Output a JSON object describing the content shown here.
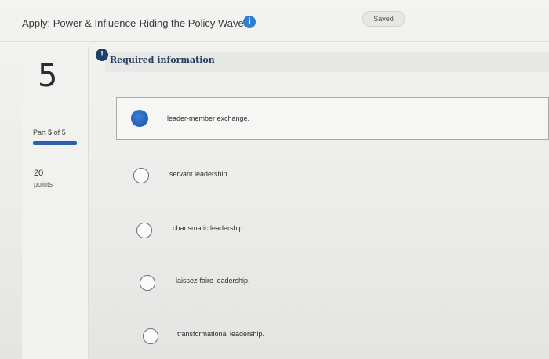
{
  "header": {
    "title": "Apply: Power & Influence-Riding the Policy Wave",
    "info_icon": "i",
    "status": "Saved"
  },
  "question": {
    "number": "5",
    "part_prefix": "Part",
    "part_current": "5",
    "part_of": "of 5",
    "progress": 1.0,
    "points_value": "20",
    "points_label": "points"
  },
  "required": {
    "badge": "!",
    "label": "Required information"
  },
  "options": [
    {
      "label": "leader-member exchange.",
      "selected": true
    },
    {
      "label": "servant leadership.",
      "selected": false
    },
    {
      "label": "charismatic leadership.",
      "selected": false
    },
    {
      "label": "laissez-faire leadership.",
      "selected": false
    },
    {
      "label": "transformational leadership.",
      "selected": false
    }
  ],
  "colors": {
    "accent": "#1f5db8",
    "info": "#2f7fd6",
    "badge": "#1f3f66"
  }
}
